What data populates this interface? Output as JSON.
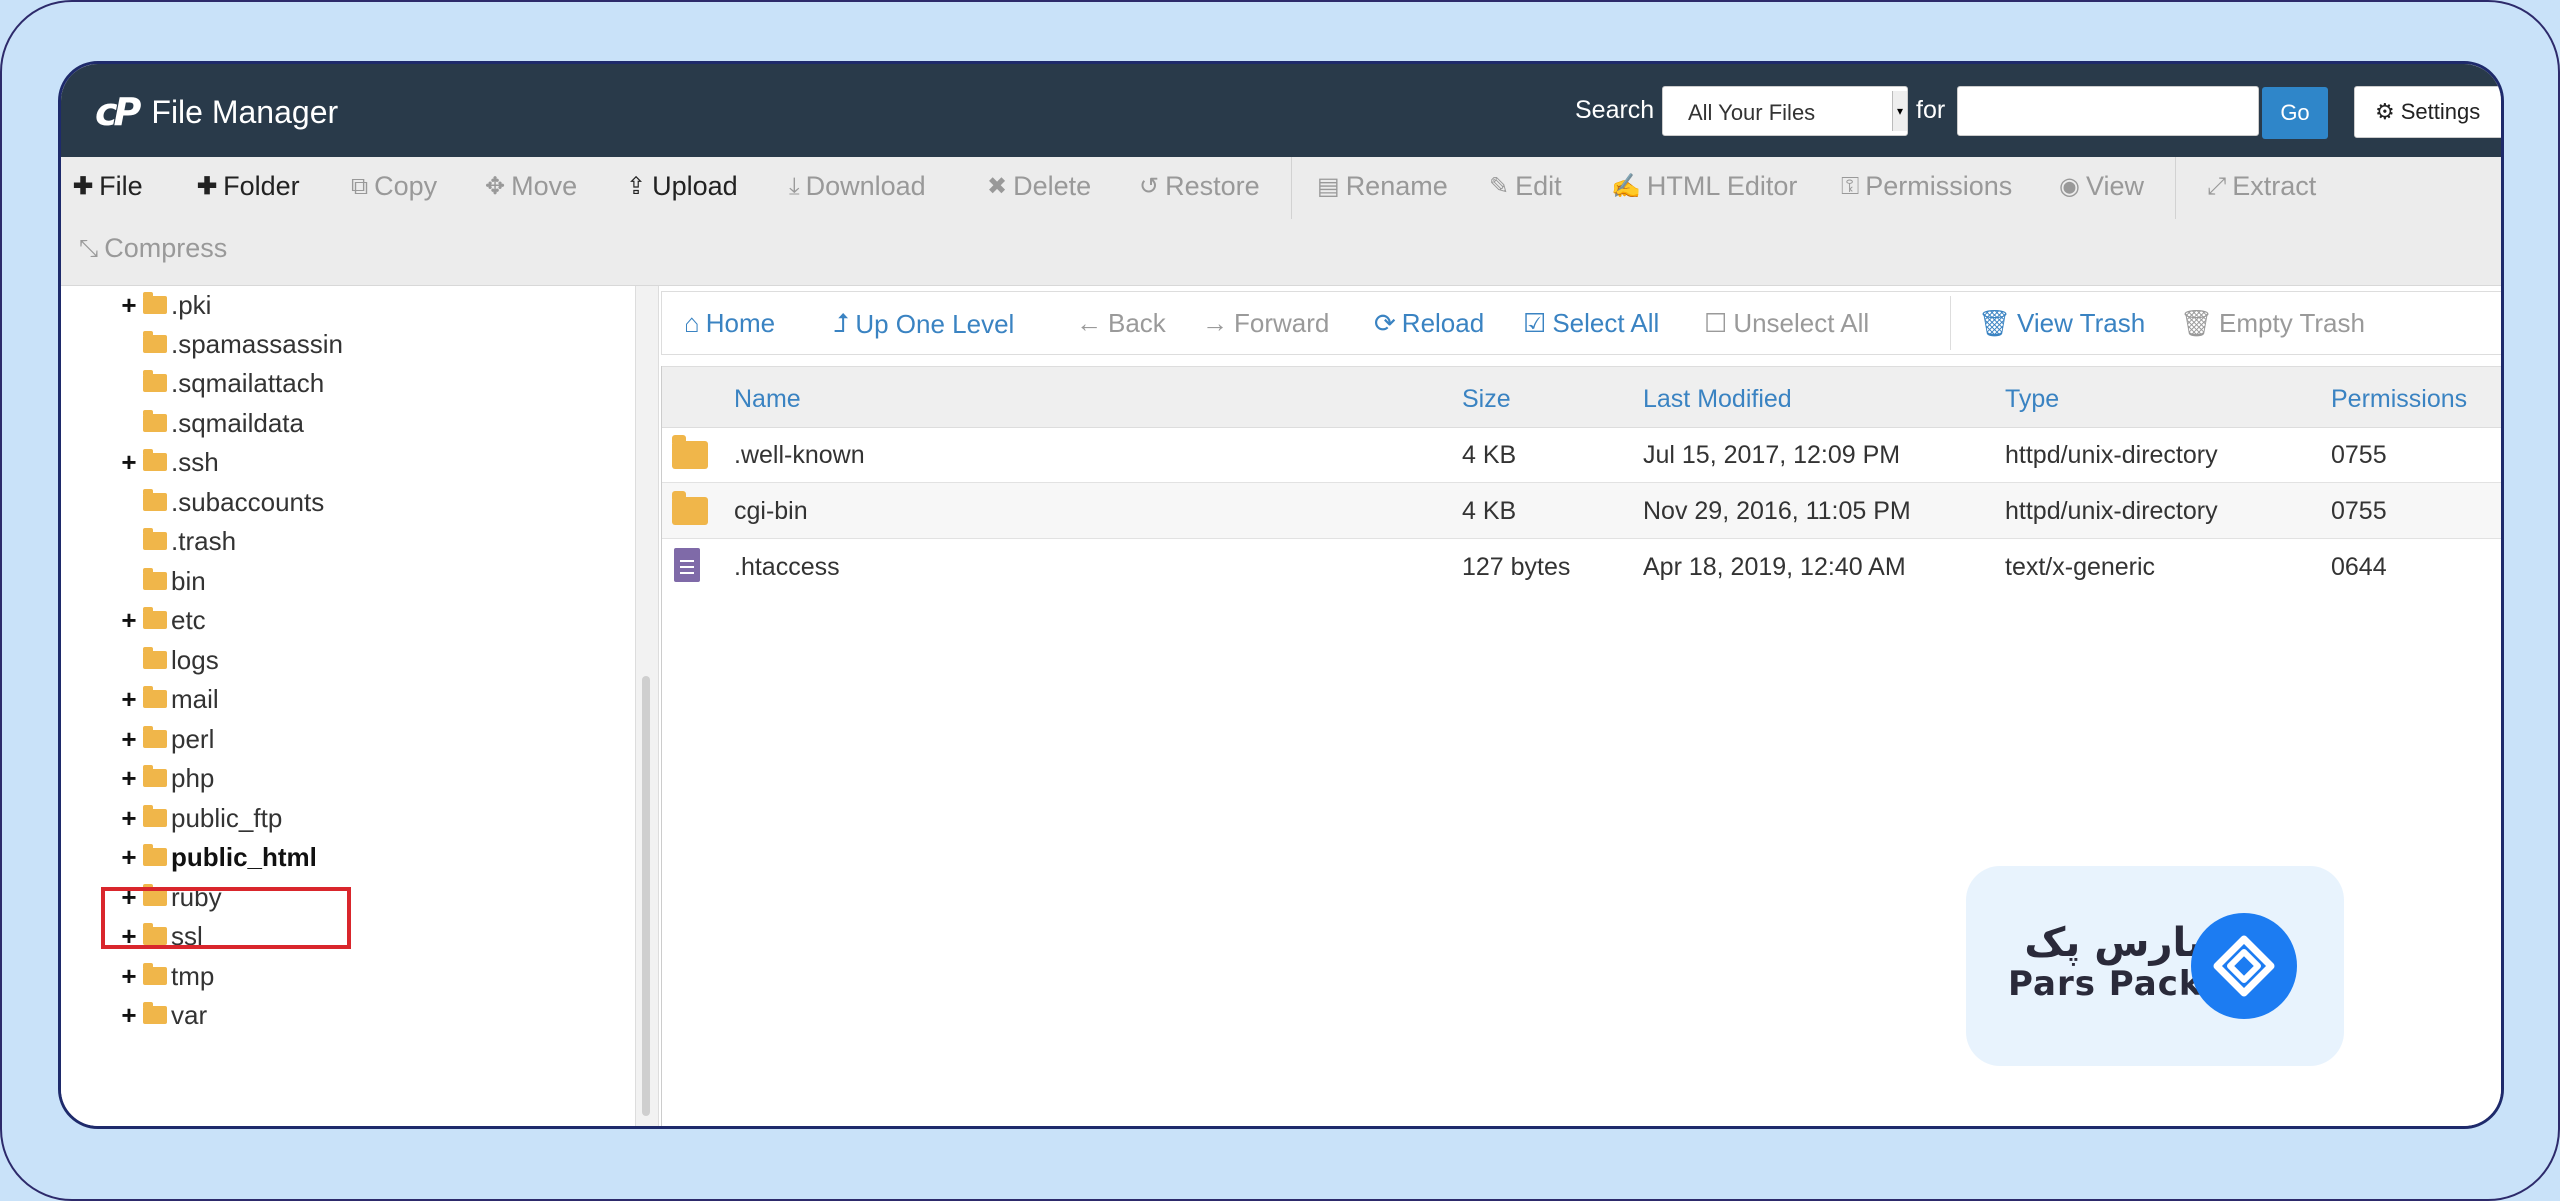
{
  "app": {
    "logo_mark": "cP",
    "title": "File Manager"
  },
  "search": {
    "label": "Search",
    "scope": "All Your Files",
    "for_label": "for",
    "value": "",
    "go_label": "Go",
    "settings_label": "Settings"
  },
  "toolbar": {
    "file": "File",
    "folder": "Folder",
    "copy": "Copy",
    "move": "Move",
    "upload": "Upload",
    "download": "Download",
    "delete": "Delete",
    "restore": "Restore",
    "rename": "Rename",
    "edit": "Edit",
    "html_editor": "HTML Editor",
    "permissions": "Permissions",
    "view": "View",
    "extract": "Extract",
    "compress": "Compress"
  },
  "tree": {
    "items": [
      {
        "label": ".pki",
        "expandable": true
      },
      {
        "label": ".spamassassin",
        "expandable": false
      },
      {
        "label": ".sqmailattach",
        "expandable": false
      },
      {
        "label": ".sqmaildata",
        "expandable": false
      },
      {
        "label": ".ssh",
        "expandable": true
      },
      {
        "label": ".subaccounts",
        "expandable": false
      },
      {
        "label": ".trash",
        "expandable": false
      },
      {
        "label": "bin",
        "expandable": false
      },
      {
        "label": "etc",
        "expandable": true
      },
      {
        "label": "logs",
        "expandable": false
      },
      {
        "label": "mail",
        "expandable": true
      },
      {
        "label": "perl",
        "expandable": true
      },
      {
        "label": "php",
        "expandable": true
      },
      {
        "label": "public_ftp",
        "expandable": true
      },
      {
        "label": "public_html",
        "expandable": true,
        "selected": true
      },
      {
        "label": "ruby",
        "expandable": true
      },
      {
        "label": "ssl",
        "expandable": true
      },
      {
        "label": "tmp",
        "expandable": true
      },
      {
        "label": "var",
        "expandable": true
      }
    ]
  },
  "nav": {
    "home": "Home",
    "up_one_level": "Up One Level",
    "back": "Back",
    "forward": "Forward",
    "reload": "Reload",
    "select_all": "Select All",
    "unselect_all": "Unselect All",
    "view_trash": "View Trash",
    "empty_trash": "Empty Trash"
  },
  "grid": {
    "columns": [
      "Name",
      "Size",
      "Last Modified",
      "Type",
      "Permissions"
    ],
    "rows": [
      {
        "icon": "folder-icon",
        "name": ".well-known",
        "size": "4 KB",
        "modified": "Jul 15, 2017, 12:09 PM",
        "type": "httpd/unix-directory",
        "perms": "0755"
      },
      {
        "icon": "folder-icon",
        "name": "cgi-bin",
        "size": "4 KB",
        "modified": "Nov 29, 2016, 11:05 PM",
        "type": "httpd/unix-directory",
        "perms": "0755"
      },
      {
        "icon": "text-file-icon",
        "name": ".htaccess",
        "size": "127 bytes",
        "modified": "Apr 18, 2019, 12:40 AM",
        "type": "text/x-generic",
        "perms": "0644"
      }
    ]
  },
  "watermark": {
    "text_fa": "پارس پک",
    "text_en": "Pars Pack"
  },
  "colors": {
    "topbar": "#293a4a",
    "link": "#3a83c2",
    "go_button": "#2f86c9",
    "folder": "#f0b64a",
    "highlight": "#d9262c",
    "brand_blue": "#1c7cf2"
  }
}
